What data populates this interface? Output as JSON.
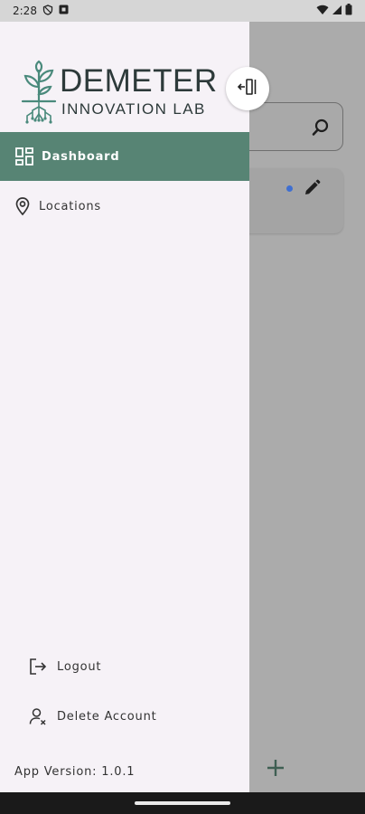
{
  "status_bar": {
    "time": "2:28",
    "icons": [
      "shield-icon",
      "app-notification-icon",
      "wifi-icon",
      "signal-icon",
      "battery-icon"
    ]
  },
  "drawer": {
    "logo": {
      "title": "DEMETER",
      "subtitle": "INNOVATION LAB",
      "icon": "plant-roots-icon"
    },
    "nav_items": [
      {
        "label": "Dashboard",
        "icon": "dashboard-icon",
        "active": true
      },
      {
        "label": "Locations",
        "icon": "location-pin-icon",
        "active": false
      }
    ],
    "bottom_items": [
      {
        "label": "Logout",
        "icon": "logout-icon"
      },
      {
        "label": "Delete Account",
        "icon": "delete-account-icon"
      }
    ],
    "app_version": "App Version: 1.0.1",
    "collapse_icon": "collapse-drawer-icon"
  },
  "background_app": {
    "search_icon": "search-icon",
    "card_icons": [
      "status-dot",
      "edit-icon"
    ],
    "fab_icon": "add-icon"
  },
  "colors": {
    "accent": "#578474",
    "drawer_bg": "#f6f2f7",
    "scrim": "#ababab",
    "status_dot": "#3f6fd1"
  }
}
